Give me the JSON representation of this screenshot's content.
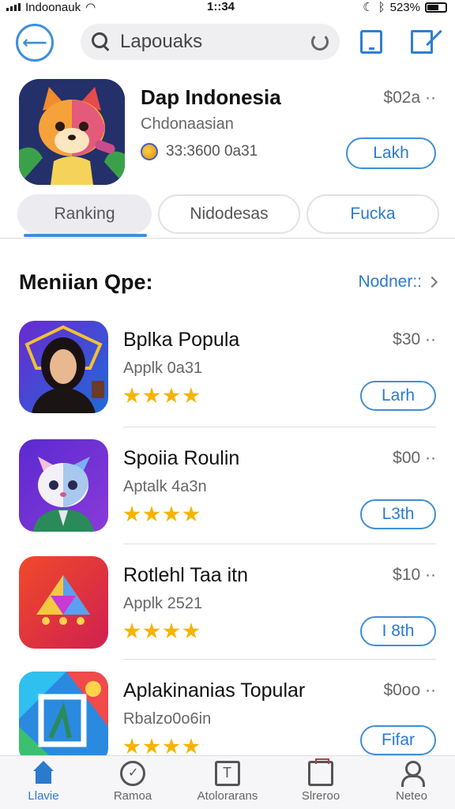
{
  "status_bar": {
    "carrier": "Indoonauk",
    "time": "1::34",
    "battery": "523%"
  },
  "header": {
    "search_text": "Lapouaks"
  },
  "featured": {
    "title": "Dap Indonesia",
    "subtitle": "Chdonaasian",
    "meta": "33:3600 0a31",
    "price": "$02a ··",
    "button": "Lakh"
  },
  "tabs": [
    {
      "label": "Ranking"
    },
    {
      "label": "Nidodesas"
    },
    {
      "label": "Fucka"
    }
  ],
  "section": {
    "title": "Meniian Qpe:",
    "more": "Nodner::"
  },
  "apps": [
    {
      "name": "Bplka Popula",
      "sub": "Applk 0a31",
      "price": "$30 ··",
      "button": "Larh"
    },
    {
      "name": "Spoiia Roulin",
      "sub": "Aptalk 4a3n",
      "price": "$00 ··",
      "button": "L3th"
    },
    {
      "name": "Rotlehl Taa itn",
      "sub": "Applk 2521",
      "price": "$10 ··",
      "button": "I 8th"
    },
    {
      "name": "Aplakinanias Topular",
      "sub": "Rbalzo0o6in",
      "price": "$0oo ··",
      "button": "Fifar"
    }
  ],
  "bottom_nav": [
    {
      "label": "Llavie",
      "icon": "home-icon"
    },
    {
      "label": "Ramoa",
      "icon": "games-icon"
    },
    {
      "label": "Atolorarans",
      "icon": "apps-icon"
    },
    {
      "label": "Slreroo",
      "icon": "store-icon"
    },
    {
      "label": "Neteo",
      "icon": "person-icon"
    }
  ],
  "colors": {
    "accent": "#2a7ad0",
    "star": "#f5b400"
  }
}
